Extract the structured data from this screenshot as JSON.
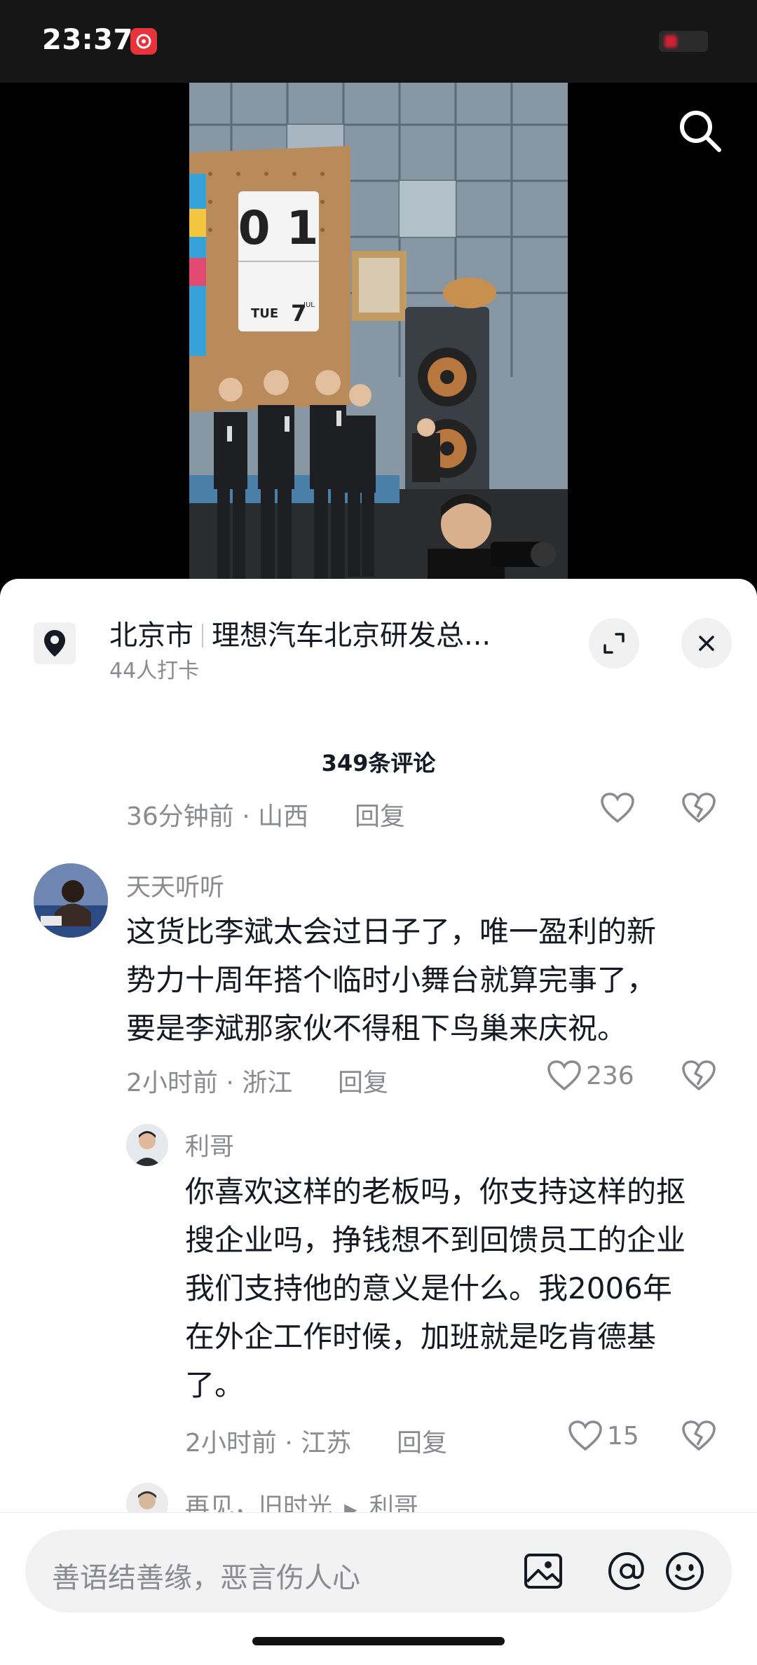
{
  "status_bar": {
    "time": "23:37"
  },
  "location": {
    "city": "北京市",
    "place": "理想汽车北京研发总...",
    "checkins": "44人打卡"
  },
  "comments_header": {
    "count": "349条评论"
  },
  "top_partial": {
    "time": "36分钟前",
    "region": "山西",
    "reply": "回复"
  },
  "comments": [
    {
      "username": "天天听听",
      "lines": [
        "这货比李斌太会过日子了，唯一盈利的新",
        "势力十周年搭个临时小舞台就算完事了，",
        "要是李斌那家伙不得租下鸟巢来庆祝。"
      ],
      "time": "2小时前",
      "region": "浙江",
      "reply": "回复",
      "likes": "236"
    }
  ],
  "replies": [
    {
      "username": "利哥",
      "lines": [
        "你喜欢这样的老板吗，你支持这样的抠",
        "搜企业吗，挣钱想不到回馈员工的企业",
        "我们支持他的意义是什么。我2006年",
        "在外企工作时候，加班就是吃肯德基",
        "了。"
      ],
      "time": "2小时前",
      "region": "江苏",
      "reply": "回复",
      "likes": "15"
    }
  ],
  "partial_next": {
    "username": "再见，旧时光",
    "reply_to": "利哥"
  },
  "input": {
    "placeholder": "善语结善缘，恶言伤人心"
  },
  "video_board": {
    "number": "0 1",
    "day": "TUE",
    "date": "7",
    "month": "JUL"
  }
}
